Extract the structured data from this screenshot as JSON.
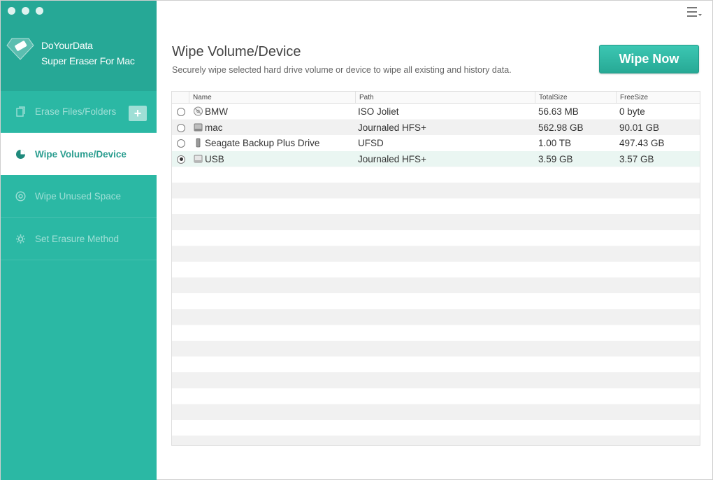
{
  "app": {
    "brand_line1": "DoYourData",
    "brand_line2": "Super Eraser For Mac"
  },
  "sidebar": {
    "items": [
      {
        "label": "Erase Files/Folders",
        "icon": "files-icon",
        "active": false
      },
      {
        "label": "Wipe Volume/Device",
        "icon": "pie-icon",
        "active": true
      },
      {
        "label": "Wipe Unused Space",
        "icon": "disk-icon",
        "active": false
      },
      {
        "label": "Set Erasure Method",
        "icon": "gear-icon",
        "active": false
      }
    ],
    "add_button": "+"
  },
  "main": {
    "title": "Wipe Volume/Device",
    "subtitle": "Securely wipe selected hard drive volume or device to wipe all existing and history data.",
    "wipe_button": "Wipe Now"
  },
  "table": {
    "headers": {
      "name": "Name",
      "path": "Path",
      "total": "TotalSize",
      "free": "FreeSize"
    },
    "rows": [
      {
        "name": "BMW",
        "path": "ISO Joliet",
        "total": "56.63 MB",
        "free": "0 byte",
        "icon": "disc-icon",
        "selected": false
      },
      {
        "name": "mac",
        "path": "Journaled HFS+",
        "total": "562.98 GB",
        "free": "90.01 GB",
        "icon": "hard-drive-icon",
        "selected": false
      },
      {
        "name": "Seagate Backup Plus Drive",
        "path": "UFSD",
        "total": "1.00 TB",
        "free": "497.43 GB",
        "icon": "external-drive-icon",
        "selected": false
      },
      {
        "name": "USB",
        "path": "Journaled HFS+",
        "total": "3.59 GB",
        "free": "3.57 GB",
        "icon": "usb-drive-icon",
        "selected": true
      }
    ]
  },
  "colors": {
    "accent": "#2bb8a4",
    "accent_dark": "#26a896"
  }
}
